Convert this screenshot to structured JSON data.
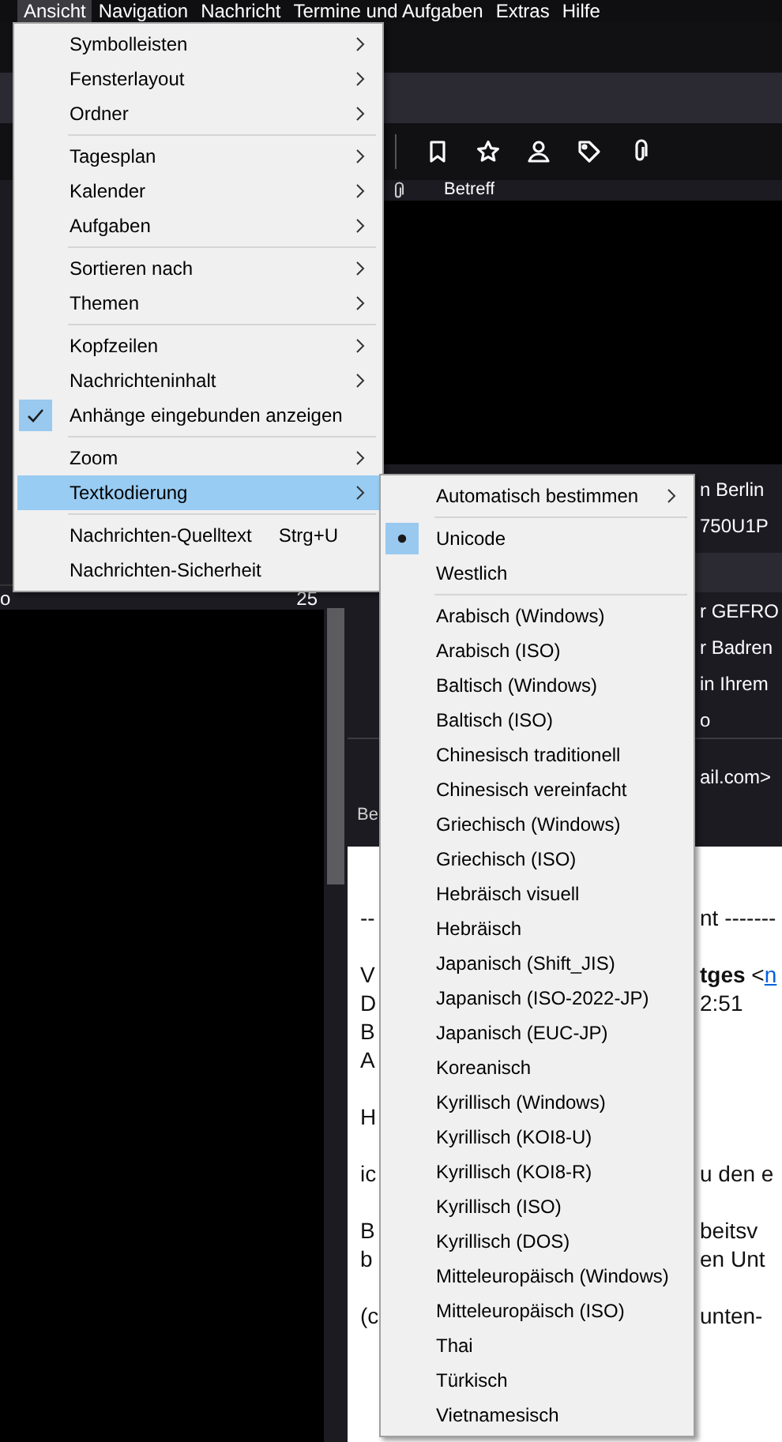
{
  "menu_bar": [
    {
      "label": "Ansicht",
      "selected": true
    },
    {
      "label": "Navigation",
      "selected": false
    },
    {
      "label": "Nachricht",
      "selected": false
    },
    {
      "label": "Termine und Aufgaben",
      "selected": false
    },
    {
      "label": "Extras",
      "selected": false
    },
    {
      "label": "Hilfe",
      "selected": false
    }
  ],
  "main_menu": {
    "groups": [
      [
        {
          "label": "Symbolleisten",
          "submenu": true,
          "checked": false,
          "selected": false
        },
        {
          "label": "Fensterlayout",
          "submenu": true,
          "checked": false,
          "selected": false
        },
        {
          "label": "Ordner",
          "submenu": true,
          "checked": false,
          "selected": false
        }
      ],
      [
        {
          "label": "Tagesplan",
          "submenu": true,
          "checked": false,
          "selected": false
        },
        {
          "label": "Kalender",
          "submenu": true,
          "checked": false,
          "selected": false
        },
        {
          "label": "Aufgaben",
          "submenu": true,
          "checked": false,
          "selected": false
        }
      ],
      [
        {
          "label": "Sortieren nach",
          "submenu": true,
          "checked": false,
          "selected": false
        },
        {
          "label": "Themen",
          "submenu": true,
          "checked": false,
          "selected": false
        }
      ],
      [
        {
          "label": "Kopfzeilen",
          "submenu": true,
          "checked": false,
          "selected": false
        },
        {
          "label": "Nachrichteninhalt",
          "submenu": true,
          "checked": false,
          "selected": false
        },
        {
          "label": "Anhänge eingebunden anzeigen",
          "submenu": false,
          "checked": true,
          "selected": false
        }
      ],
      [
        {
          "label": "Zoom",
          "submenu": true,
          "checked": false,
          "selected": false
        },
        {
          "label": "Textkodierung",
          "submenu": true,
          "checked": false,
          "selected": true
        }
      ],
      [
        {
          "label": "Nachrichten-Quelltext",
          "shortcut": "Strg+U",
          "submenu": false,
          "checked": false,
          "selected": false
        },
        {
          "label": "Nachrichten-Sicherheit",
          "submenu": false,
          "checked": false,
          "selected": false
        }
      ]
    ]
  },
  "encoding_menu": {
    "groups": [
      [
        {
          "label": "Automatisch bestimmen",
          "submenu": true,
          "checked": false,
          "selected": false
        }
      ],
      [
        {
          "label": "Unicode",
          "submenu": false,
          "checked": true,
          "selected": false
        },
        {
          "label": "Westlich",
          "submenu": false,
          "checked": false,
          "selected": false
        }
      ],
      [
        {
          "label": "Arabisch (Windows)",
          "submenu": false,
          "checked": false,
          "selected": false
        },
        {
          "label": "Arabisch (ISO)",
          "submenu": false,
          "checked": false,
          "selected": false
        },
        {
          "label": "Baltisch (Windows)",
          "submenu": false,
          "checked": false,
          "selected": false
        },
        {
          "label": "Baltisch (ISO)",
          "submenu": false,
          "checked": false,
          "selected": false
        },
        {
          "label": "Chinesisch traditionell",
          "submenu": false,
          "checked": false,
          "selected": false
        },
        {
          "label": "Chinesisch vereinfacht",
          "submenu": false,
          "checked": false,
          "selected": false
        },
        {
          "label": "Griechisch (Windows)",
          "submenu": false,
          "checked": false,
          "selected": false
        },
        {
          "label": "Griechisch (ISO)",
          "submenu": false,
          "checked": false,
          "selected": false
        },
        {
          "label": "Hebräisch visuell",
          "submenu": false,
          "checked": false,
          "selected": false
        },
        {
          "label": "Hebräisch",
          "submenu": false,
          "checked": false,
          "selected": false
        },
        {
          "label": "Japanisch (Shift_JIS)",
          "submenu": false,
          "checked": false,
          "selected": false
        },
        {
          "label": "Japanisch (ISO-2022-JP)",
          "submenu": false,
          "checked": false,
          "selected": false
        },
        {
          "label": "Japanisch (EUC-JP)",
          "submenu": false,
          "checked": false,
          "selected": false
        },
        {
          "label": "Koreanisch",
          "submenu": false,
          "checked": false,
          "selected": false
        },
        {
          "label": "Kyrillisch (Windows)",
          "submenu": false,
          "checked": false,
          "selected": false
        },
        {
          "label": "Kyrillisch (KOI8-U)",
          "submenu": false,
          "checked": false,
          "selected": false
        },
        {
          "label": "Kyrillisch (KOI8-R)",
          "submenu": false,
          "checked": false,
          "selected": false
        },
        {
          "label": "Kyrillisch (ISO)",
          "submenu": false,
          "checked": false,
          "selected": false
        },
        {
          "label": "Kyrillisch (DOS)",
          "submenu": false,
          "checked": false,
          "selected": false
        },
        {
          "label": "Mitteleuropäisch (Windows)",
          "submenu": false,
          "checked": false,
          "selected": false
        },
        {
          "label": "Mitteleuropäisch (ISO)",
          "submenu": false,
          "checked": false,
          "selected": false
        },
        {
          "label": "Thai",
          "submenu": false,
          "checked": false,
          "selected": false
        },
        {
          "label": "Türkisch",
          "submenu": false,
          "checked": false,
          "selected": false
        },
        {
          "label": "Vietnamesisch",
          "submenu": false,
          "checked": false,
          "selected": false
        }
      ]
    ]
  },
  "folder_pane": {
    "row": {
      "label": "o",
      "count": "25"
    }
  },
  "message_list": {
    "column": "Betreff"
  },
  "header_pane": {
    "rows": [
      {
        "right": "n Berlin"
      },
      {
        "right": "750U1P"
      }
    ],
    "rows_2": [
      {
        "right": "r GEFRO"
      },
      {
        "right": "r Badren"
      },
      {
        "right": "in Ihrem"
      },
      {
        "right": "o"
      }
    ],
    "rows_3": [
      {
        "right": "ail.com>"
      },
      {
        "left": "Be"
      }
    ]
  },
  "body": {
    "paragraphs": [
      [
        {
          "left": "--",
          "right": "nt -------"
        }
      ],
      [
        {
          "left": "V",
          "right": "**tges** <",
          "link": "n"
        },
        {
          "left": "D",
          "right": "2:51"
        },
        {
          "left": "B"
        },
        {
          "left": "A"
        }
      ],
      [
        {
          "left": "H"
        }
      ],
      [
        {
          "left": "ic",
          "right": "u den e"
        }
      ],
      [
        {
          "left": "B",
          "right": "beitsv"
        },
        {
          "left": "b",
          "right": "en Unt"
        }
      ],
      [
        {
          "left": "(c",
          "right": "unten-"
        }
      ]
    ]
  }
}
